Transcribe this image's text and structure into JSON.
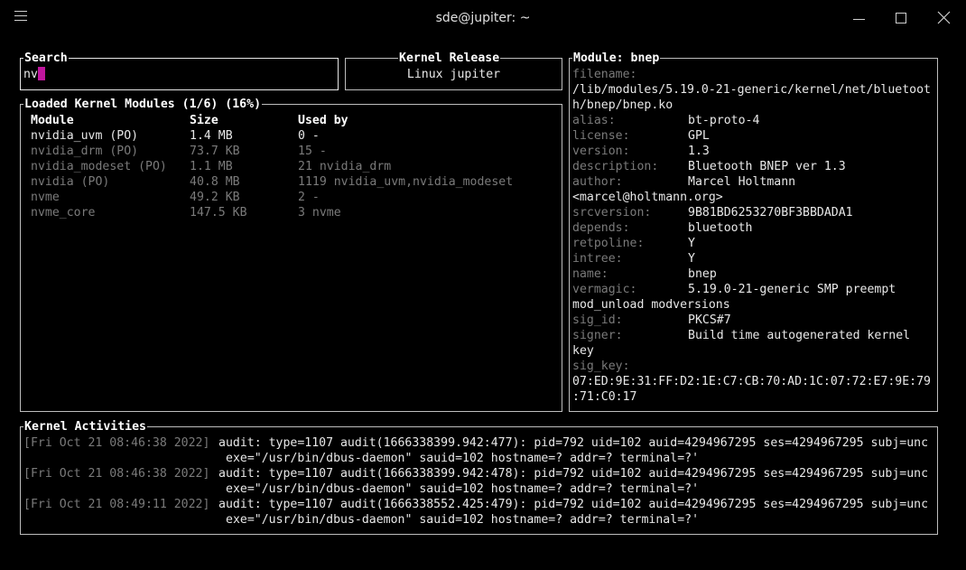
{
  "window": {
    "title": "sde@jupiter: ~",
    "menu_icon": "hamburger-icon",
    "minimize_icon": "minimize-icon",
    "maximize_icon": "maximize-icon",
    "close_icon": "close-icon"
  },
  "search": {
    "title": "Search",
    "value": "nv"
  },
  "kernel_release": {
    "title": "Kernel Release",
    "value": "Linux jupiter"
  },
  "modules": {
    "title": "Loaded Kernel Modules (1/6) (16%)",
    "headers": [
      "Module",
      "Size",
      "Used by"
    ],
    "rows": [
      {
        "name": "nvidia_uvm (PO)",
        "size": "1.4 MB",
        "used": "0 -",
        "selected": true
      },
      {
        "name": "nvidia_drm (PO)",
        "size": "73.7 KB",
        "used": "15 -",
        "selected": false
      },
      {
        "name": "nvidia_modeset (PO)",
        "size": "1.1 MB",
        "used": "21 nvidia_drm",
        "selected": false
      },
      {
        "name": "nvidia (PO)",
        "size": "40.8 MB",
        "used": "1119 nvidia_uvm,nvidia_modeset",
        "selected": false
      },
      {
        "name": "nvme",
        "size": "49.2 KB",
        "used": "2 -",
        "selected": false
      },
      {
        "name": "nvme_core",
        "size": "147.5 KB",
        "used": "3 nvme",
        "selected": false
      }
    ]
  },
  "module_info": {
    "title": "Module: bnep",
    "lines": [
      {
        "key": "filename:",
        "val": ""
      },
      {
        "key": "",
        "val": "/lib/modules/5.19.0-21-generic/kernel/net/bluetoot"
      },
      {
        "key": "",
        "val": "h/bnep/bnep.ko"
      },
      {
        "key": "alias:",
        "val": "bt-proto-4"
      },
      {
        "key": "license:",
        "val": "GPL"
      },
      {
        "key": "version:",
        "val": "1.3"
      },
      {
        "key": "description:",
        "val": "Bluetooth BNEP ver 1.3"
      },
      {
        "key": "author:",
        "val": "Marcel Holtmann"
      },
      {
        "key": "",
        "val": "<marcel@holtmann.org>"
      },
      {
        "key": "srcversion:",
        "val": "9B81BD6253270BF3BBDADA1"
      },
      {
        "key": "depends:",
        "val": "bluetooth"
      },
      {
        "key": "retpoline:",
        "val": "Y"
      },
      {
        "key": "intree:",
        "val": "Y"
      },
      {
        "key": "name:",
        "val": "bnep"
      },
      {
        "key": "vermagic:",
        "val": "5.19.0-21-generic SMP preempt"
      },
      {
        "key": "",
        "val": "mod_unload modversions"
      },
      {
        "key": "sig_id:",
        "val": "PKCS#7"
      },
      {
        "key": "signer:",
        "val": "Build time autogenerated kernel"
      },
      {
        "key": "",
        "val": "key"
      },
      {
        "key": "sig_key:",
        "val": ""
      },
      {
        "key": "",
        "val": "07:ED:9E:31:FF:D2:1E:C7:CB:70:AD:1C:07:72:E7:9E:79"
      },
      {
        "key": "",
        "val": ":71:C0:17"
      }
    ]
  },
  "activities": {
    "title": "Kernel Activities",
    "entries": [
      {
        "time": "[Fri Oct 21 08:46:38 2022]",
        "line1": "audit: type=1107 audit(1666338399.942:477): pid=792 uid=102 auid=4294967295 ses=4294967295 subj=unc",
        "line2": "exe=\"/usr/bin/dbus-daemon\" sauid=102 hostname=? addr=? terminal=?'"
      },
      {
        "time": "[Fri Oct 21 08:46:38 2022]",
        "line1": "audit: type=1107 audit(1666338399.942:478): pid=792 uid=102 auid=4294967295 ses=4294967295 subj=unc",
        "line2": "exe=\"/usr/bin/dbus-daemon\" sauid=102 hostname=? addr=? terminal=?'"
      },
      {
        "time": "[Fri Oct 21 08:49:11 2022]",
        "line1": "audit: type=1107 audit(1666338552.425:479): pid=792 uid=102 auid=4294967295 ses=4294967295 subj=unc",
        "line2": "exe=\"/usr/bin/dbus-daemon\" sauid=102 hostname=? addr=? terminal=?'"
      }
    ]
  }
}
